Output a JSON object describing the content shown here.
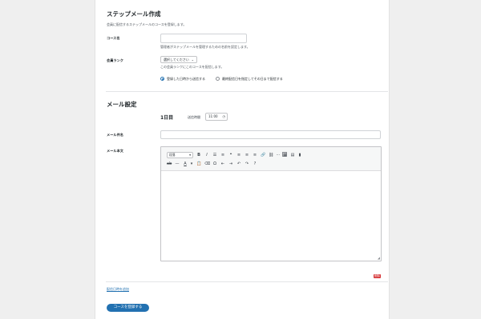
{
  "step_mail": {
    "title": "ステップメール作成",
    "description": "会員に配信するステップメールのコースを登録します。",
    "course_name": {
      "label": "コース名",
      "value": "",
      "help": "管理者がステップメールを管理するための名前を設定します。"
    },
    "member_rank": {
      "label": "会員ランク",
      "selected": "選択してください",
      "help": "この会員ランクにこのコースを配信します。",
      "options": [
        {
          "label": "登録した日時から送信する",
          "checked": true
        },
        {
          "label": "最終配信日を指定してその日まで配信する",
          "checked": false
        }
      ]
    }
  },
  "mail_settings": {
    "title": "メール設定",
    "day_label": "1日目",
    "send_time_label": "送信時間",
    "send_time_value": "11:00",
    "subject_label": "メール件名",
    "subject_value": "",
    "body_label": "メール本文",
    "editor": {
      "format_select": "段落",
      "row1_icons": [
        "bold-icon",
        "italic-icon",
        "bulleted-list-icon",
        "numbered-list-icon",
        "blockquote-icon",
        "align-left-icon",
        "align-center-icon",
        "align-right-icon",
        "link-icon",
        "unlink-icon",
        "read-more-icon",
        "fullscreen-icon",
        "toolbar-toggle-icon",
        "table-icon",
        "chart-icon"
      ],
      "row2_icons": [
        "strikethrough-icon",
        "horizontal-line-icon",
        "text-color-icon",
        "paste-text-icon",
        "clear-format-icon",
        "special-char-icon",
        "outdent-icon",
        "indent-icon",
        "undo-icon",
        "redo-icon",
        "help-icon"
      ]
    },
    "delete_badge": "削除",
    "add_delivery_link": "配信日時を追加"
  },
  "submit_button": "コースを登録する",
  "colors": {
    "accent": "#2271b1",
    "danger": "#d63638",
    "page_bg": "#efefef"
  }
}
